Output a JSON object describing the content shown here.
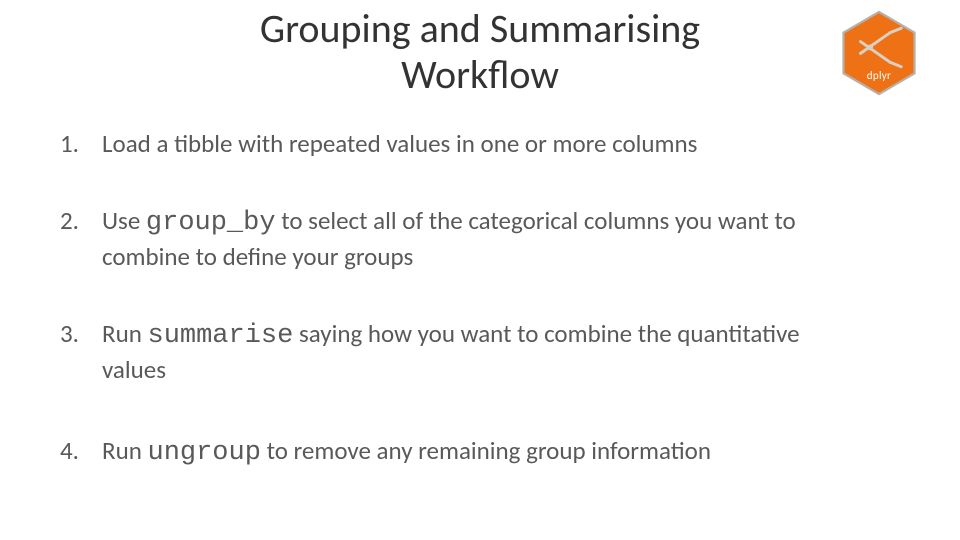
{
  "title_line1": "Grouping and Summarising",
  "title_line2": "Workflow",
  "logo": {
    "name": "dplyr",
    "bg": "#ee7116",
    "stroke": "#b6b0a9"
  },
  "items": [
    {
      "num": "1.",
      "pre": "Load a tibble with repeated values in one or more columns",
      "code": "",
      "post": "",
      "post2": ""
    },
    {
      "num": "2.",
      "pre": "Use ",
      "code": "group_by",
      "post": " to select all of the categorical columns you want to ",
      "post2": "combine to define your groups"
    },
    {
      "num": "3.",
      "pre": "Run ",
      "code": "summarise",
      "post": " saying how you want to combine the quantitative ",
      "post2": "values"
    },
    {
      "num": "4.",
      "pre": "Run ",
      "code": "ungroup",
      "post": " to remove any remaining group information",
      "post2": ""
    }
  ]
}
